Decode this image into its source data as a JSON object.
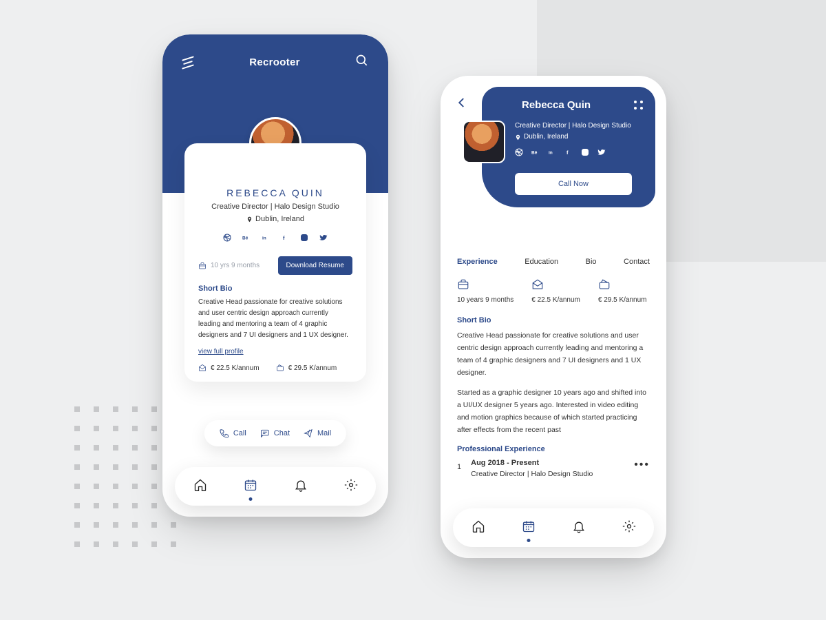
{
  "app_name": "Recrooter",
  "profile": {
    "name_upper": "REBECCA QUIN",
    "name": "Rebecca Quin",
    "role": "Creative Director | Halo Design Studio",
    "location": "Dublin, Ireland",
    "experience_short": "10 yrs 9 months",
    "experience_long": "10 years 9 months",
    "salary_current": "€ 22.5 K/annum",
    "salary_expected": "€ 29.5 K/annum",
    "download_label": "Download Resume",
    "short_bio_heading": "Short Bio",
    "short_bio": "Creative Head passionate for creative solutions and user centric design approach currently leading and mentoring a team of 4 graphic designers and 7 UI  designers and 1 UX designer.",
    "view_full": "view full profile",
    "call_now": "Call Now",
    "social": [
      "dribbble",
      "behance",
      "linkedin",
      "facebook",
      "instagram",
      "twitter"
    ]
  },
  "actions": {
    "call": "Call",
    "chat": "Chat",
    "mail": "Mail"
  },
  "tabs": [
    "Experience",
    "Education",
    "Bio",
    "Contact"
  ],
  "bio_extra": "Started as a graphic designer 10 years ago and shifted into a UI/UX designer 5 years ago. Interested in video editing and motion graphics because of which started practicing after effects from the recent past",
  "prof_exp_heading": "Professional Experience",
  "exp_items": [
    {
      "n": "1",
      "dates": "Aug 2018 - Present",
      "role": "Creative Director | Halo Design Studio"
    }
  ]
}
